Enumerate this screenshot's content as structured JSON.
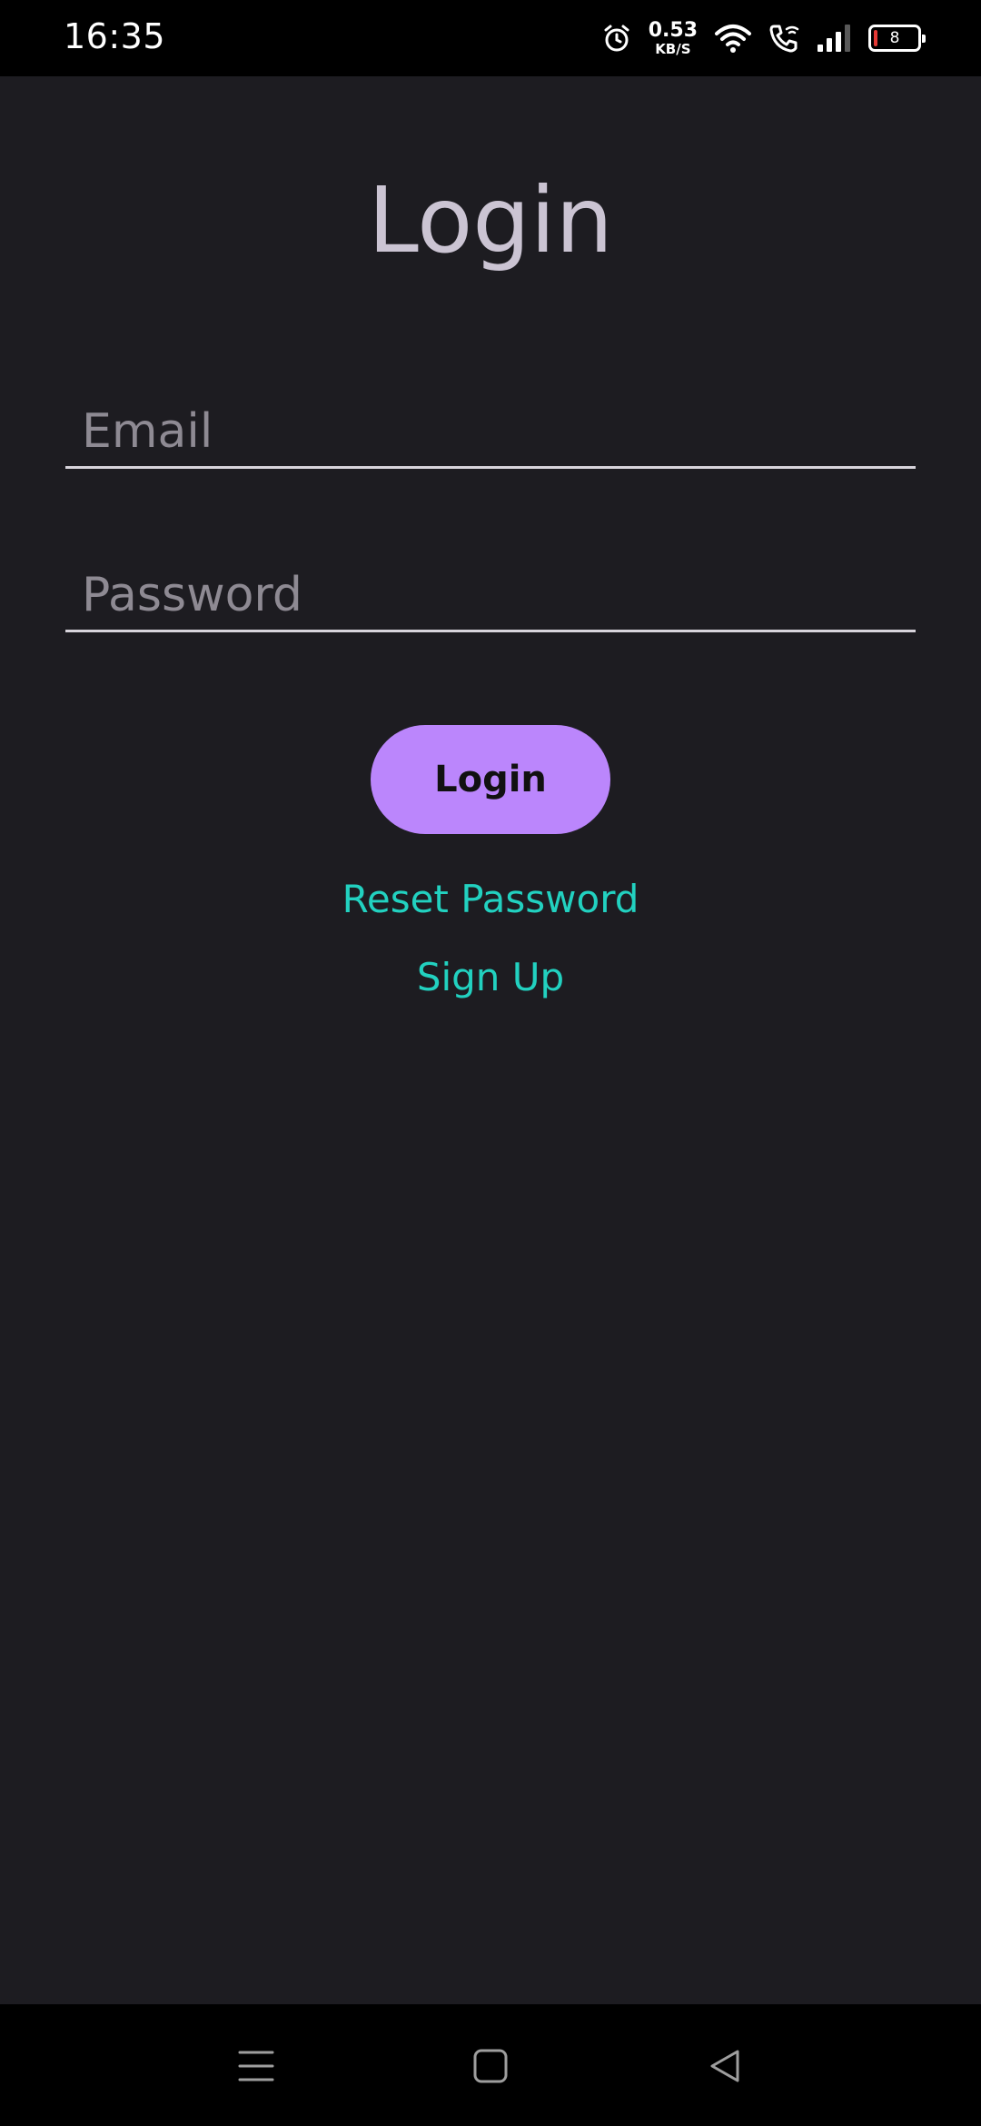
{
  "status_bar": {
    "time": "16:35",
    "net_speed_value": "0.53",
    "net_speed_unit": "KB/S",
    "battery_level": "8",
    "icons": [
      "alarm-icon",
      "wifi-icon",
      "wifi-call-icon",
      "signal-icon",
      "battery-icon"
    ]
  },
  "login_form": {
    "title": "Login",
    "email_placeholder": "Email",
    "password_placeholder": "Password",
    "login_button_label": "Login",
    "reset_password_link": "Reset Password",
    "sign_up_link": "Sign Up"
  },
  "nav_bar": {
    "icons": [
      "menu-icon",
      "home-icon",
      "back-icon"
    ]
  },
  "colors": {
    "background": "#1d1c21",
    "title": "#cbc4d3",
    "button": "#bb86fc",
    "link": "#22d1c0",
    "field_underline": "#d8d4dc",
    "placeholder": "#8e8a93"
  }
}
